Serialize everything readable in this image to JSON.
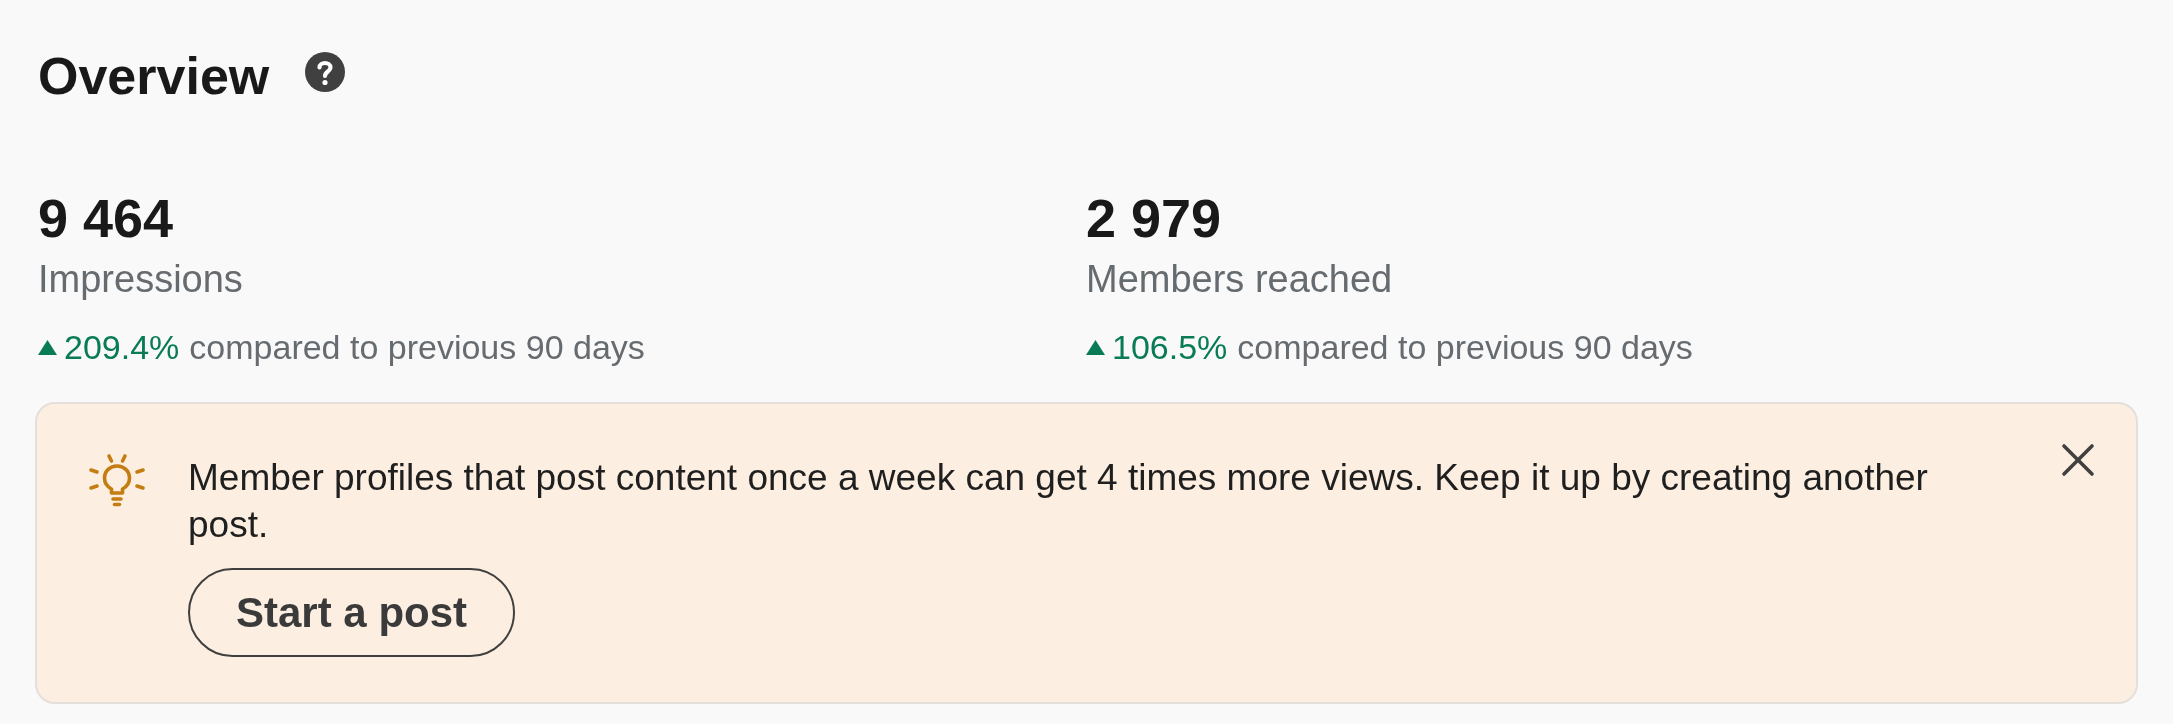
{
  "header": {
    "title": "Overview"
  },
  "metrics": [
    {
      "value": "9 464",
      "label": "Impressions",
      "increase": true,
      "change": "209.4%",
      "comparison": "compared to previous 90 days"
    },
    {
      "value": "2 979",
      "label": "Members reached",
      "increase": true,
      "change": "106.5%",
      "comparison": "compared to previous 90 days"
    }
  ],
  "tip": {
    "message": "Member profiles that post content once a week can get 4 times more views. Keep it up by creating another post.",
    "button": "Start a post"
  }
}
